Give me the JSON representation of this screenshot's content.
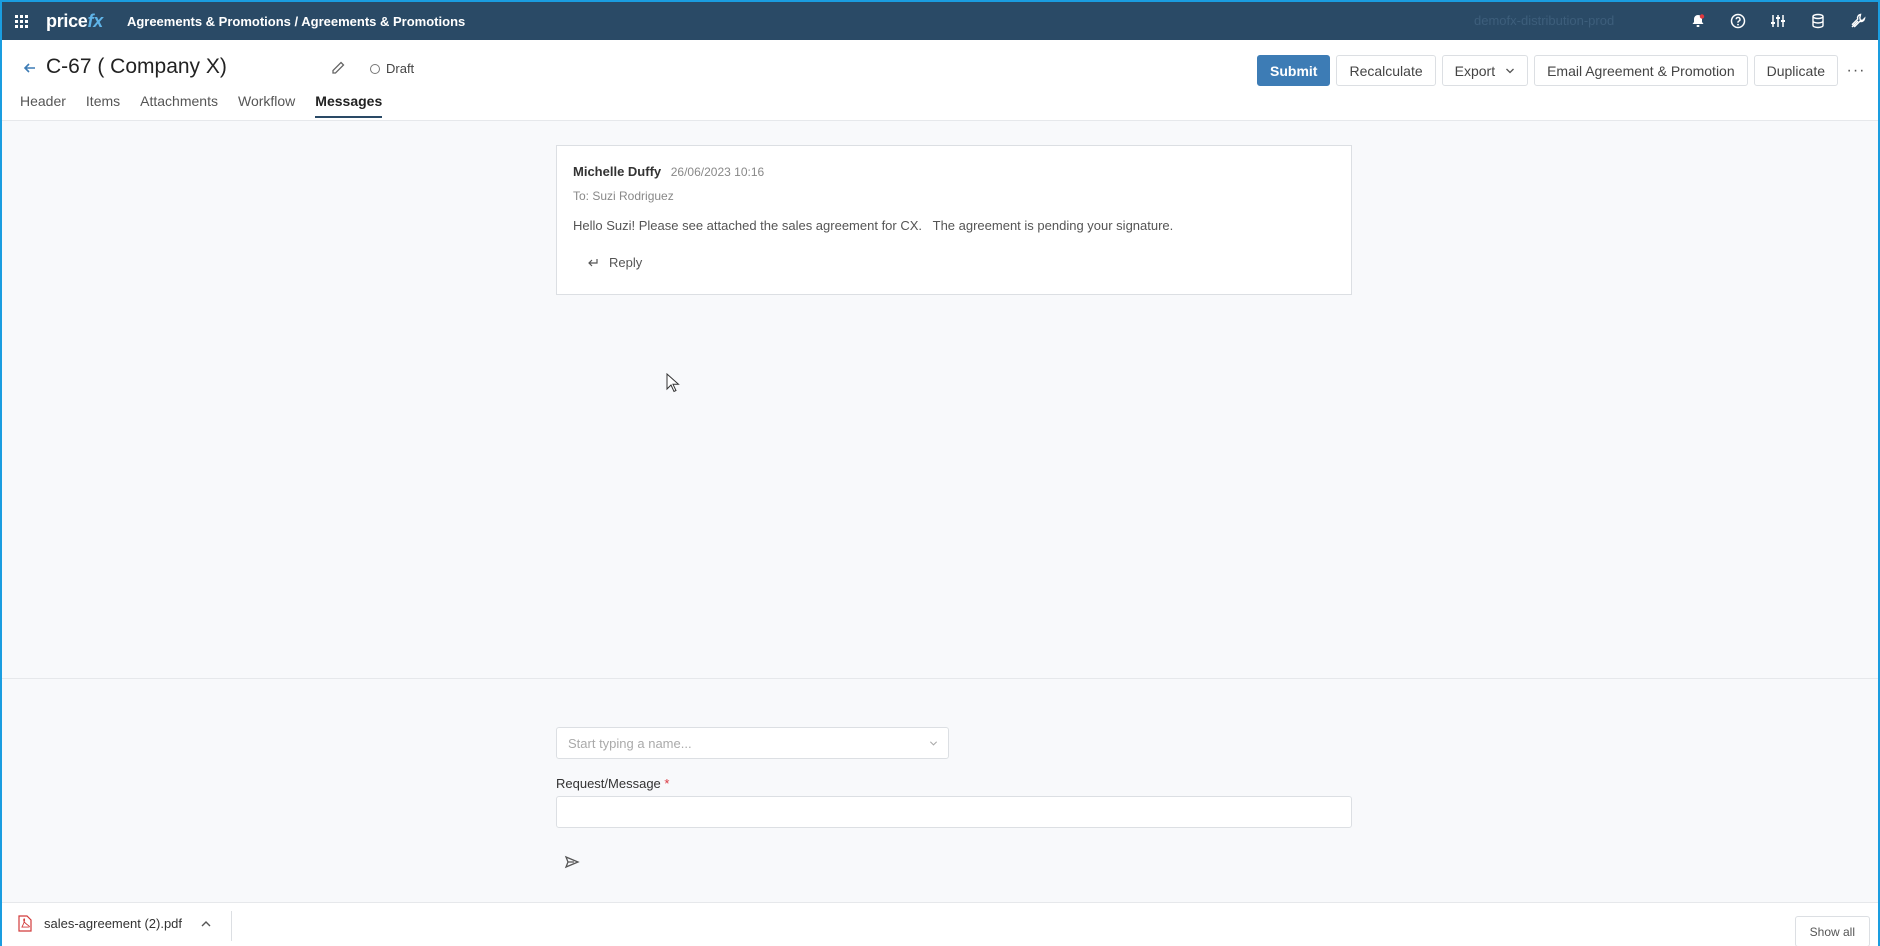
{
  "topbar": {
    "logo_price": "price",
    "logo_fx": "fx",
    "breadcrumb": "Agreements & Promotions / Agreements & Promotions",
    "environment": "demofx-distribution-prod",
    "icons": [
      "bell-icon",
      "help-icon",
      "sliders-icon",
      "database-icon",
      "tools-icon"
    ]
  },
  "document": {
    "title": "C-67 ( Company X)",
    "status": "Draft"
  },
  "tabs": [
    {
      "label": "Header"
    },
    {
      "label": "Items"
    },
    {
      "label": "Attachments"
    },
    {
      "label": "Workflow"
    },
    {
      "label": "Messages",
      "active": true
    }
  ],
  "actions": {
    "submit": "Submit",
    "recalculate": "Recalculate",
    "export": "Export",
    "email": "Email Agreement & Promotion",
    "duplicate": "Duplicate",
    "more": "···"
  },
  "message": {
    "author": "Michelle Duffy",
    "date": "26/06/2023 10:16",
    "to": "To: Suzi Rodriguez",
    "body": "Hello Suzi! Please see attached the sales agreement for CX.   The agreement is pending your signature.",
    "reply_label": "Reply"
  },
  "compose": {
    "recipient_placeholder": "Start typing a name...",
    "message_label": "Request/Message",
    "required_mark": "*"
  },
  "downloads": {
    "file_name": "sales-agreement (2).pdf",
    "show_all": "Show all"
  },
  "colors": {
    "topbar": "#2a4a66",
    "primary": "#3d7cb5",
    "frame": "#1a9de0"
  }
}
